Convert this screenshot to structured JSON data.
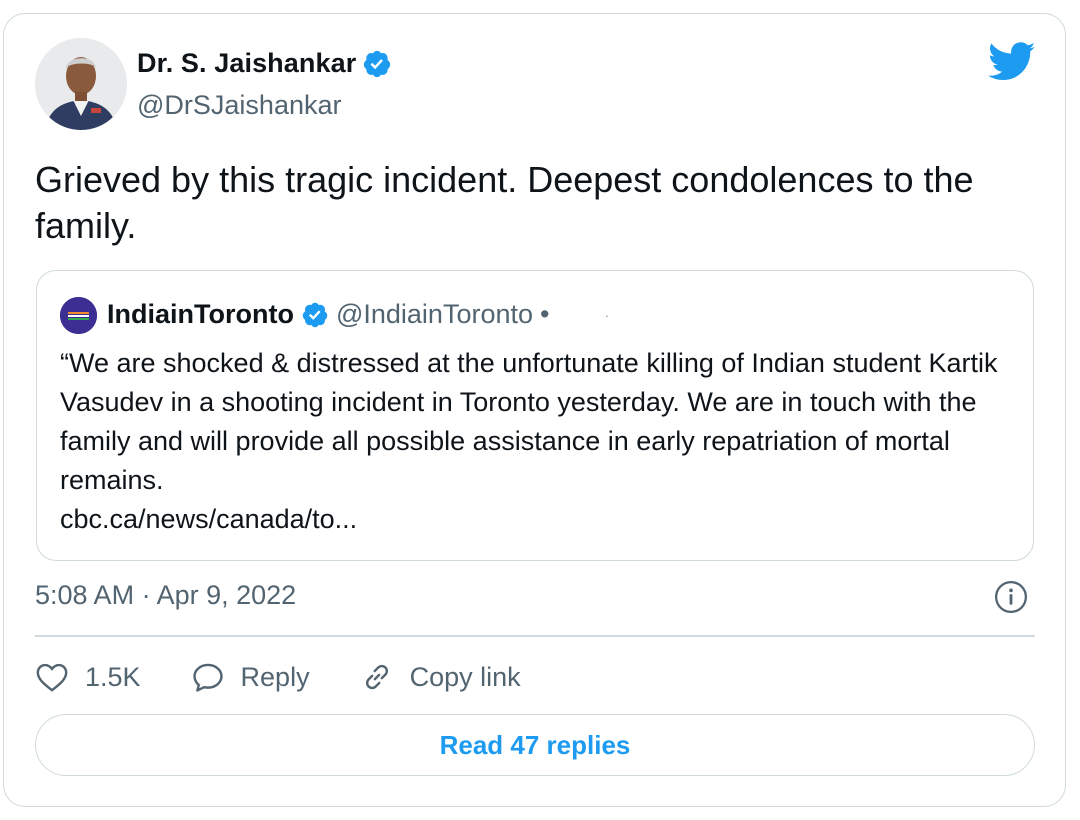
{
  "author": {
    "name": "Dr. S. Jaishankar",
    "handle": "@DrSJaishankar",
    "verified_icon": "verified-badge-icon",
    "brand_icon": "twitter-bird-icon"
  },
  "tweet": {
    "text": "Grieved by this tragic incident. Deepest condolences to the family."
  },
  "quoted_tweet": {
    "name": "IndiainToronto",
    "handle": "@IndiainToronto",
    "bullet": "•",
    "separator": "·",
    "body": "“We are shocked & distressed at the unfortunate killing of Indian student Kartik Vasudev in a shooting incident in Toronto yesterday. We are in touch with the family and will provide all possible assistance in early repatriation of mortal remains.",
    "link": "cbc.ca/news/canada/to..."
  },
  "meta": {
    "timestamp": "5:08 AM · Apr 9, 2022",
    "info_icon": "info-icon"
  },
  "actions": {
    "likes": "1.5K",
    "reply": "Reply",
    "copy_link": "Copy link"
  },
  "read_replies": "Read 47 replies",
  "colors": {
    "accent": "#1d9bf0",
    "text_primary": "#0f1419",
    "text_secondary": "#536471",
    "border": "#cfd9de"
  }
}
